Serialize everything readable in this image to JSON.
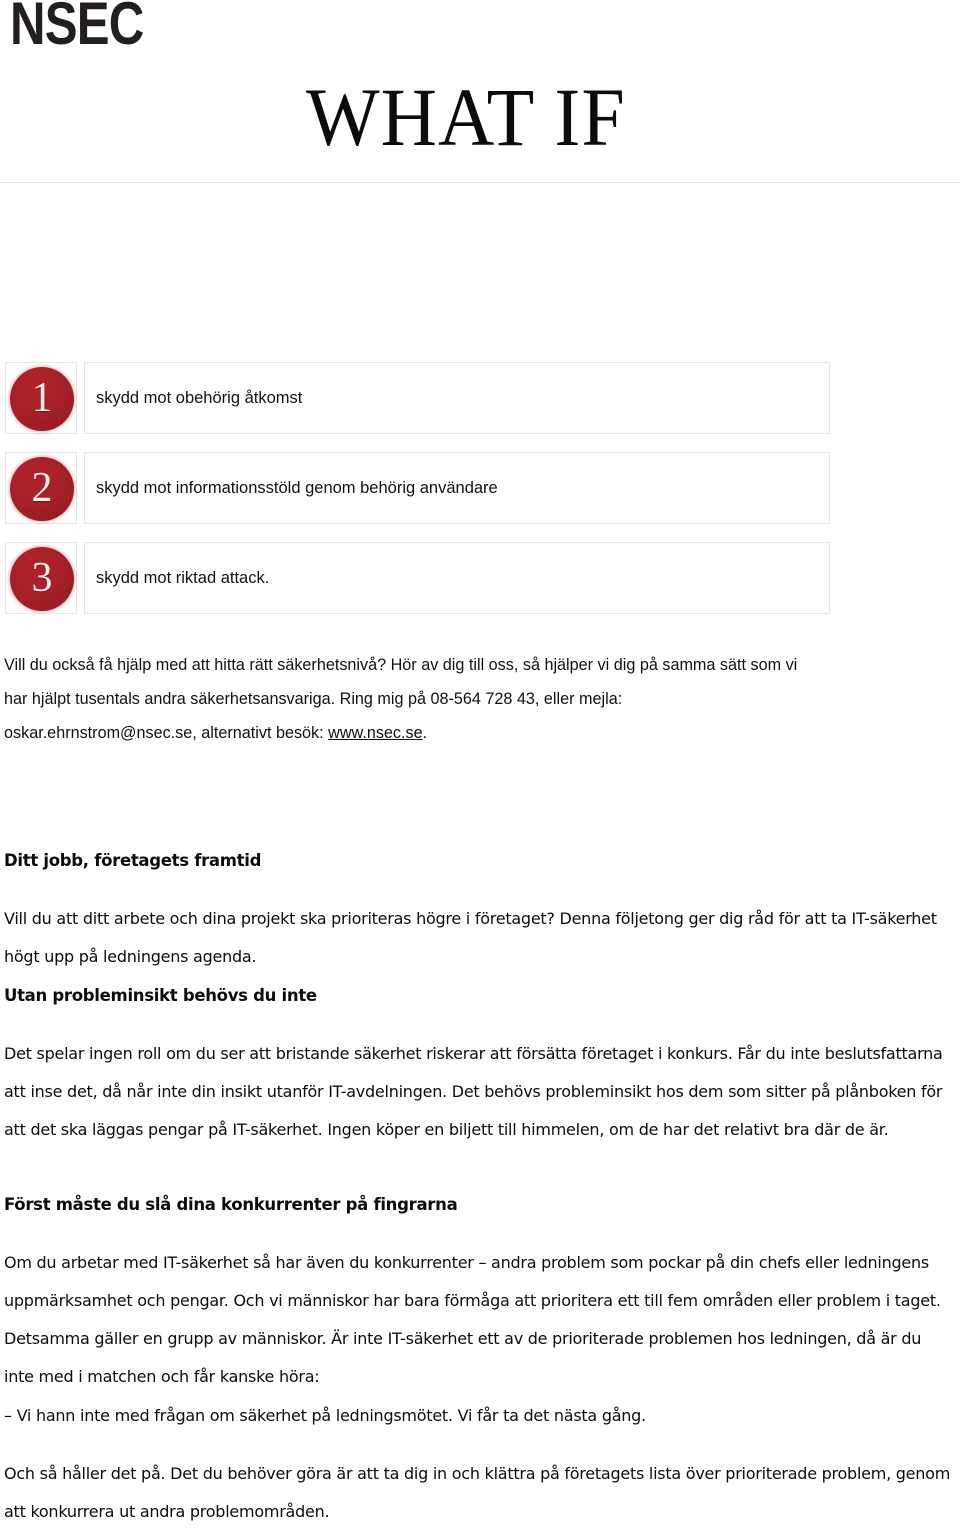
{
  "header": {
    "brand": "NSEC",
    "title": "WHAT IF"
  },
  "numbered_list": {
    "items": [
      {
        "number": "1",
        "label": "skydd mot obehörig åtkomst"
      },
      {
        "number": "2",
        "label": "skydd mot informationsstöld genom behörig användare"
      },
      {
        "number": "3",
        "label": "skydd mot riktad attack."
      }
    ]
  },
  "contact": {
    "line1": "Vill du också få hjälp med att hitta rätt säkerhetsnivå? Hör av dig till oss, så hjälper vi dig på",
    "line2": "samma sätt som vi har hjälpt tusentals andra säkerhetsansvariga. Ring mig på 08-564 728 43,",
    "line3_before": "eller mejla: oskar.ehrnstrom@nsec.se, alternativt besök: ",
    "link": "www.nsec.se",
    "line3_after": ".",
    "phone": "08-564 728 43",
    "email": "oskar.ehrnstrom@nsec.se"
  },
  "sections": [
    {
      "id": "ditt-jobb",
      "heading": "Ditt jobb, företagets framtid",
      "body": "Vill du att ditt arbete och dina projekt ska prioriteras högre i företaget? Denna följetong ger dig råd för att ta IT-säkerhet högt upp på ledningens agenda."
    },
    {
      "id": "utan-probleminsikt",
      "heading": "Utan probleminsikt behövs du inte",
      "body": "Det spelar ingen roll om du ser att bristande säkerhet riskerar att försätta företaget i konkurs. Får du inte beslutsfattarna att inse det, då når inte din insikt utanför IT-avdelningen. Det behövs probleminsikt hos dem som sitter på plånboken för att det ska läggas pengar på IT-säkerhet. Ingen köper en biljett till himmelen, om de har det relativt bra där de är."
    },
    {
      "id": "forst-maste",
      "heading": "Först måste du slå dina konkurrenter på fingrarna",
      "body": "Om du arbetar med IT-säkerhet så har även du konkurrenter – andra problem som pockar på din chefs eller ledningens uppmärksamhet och pengar. Och vi människor har bara förmåga att prioritera ett till fem områden eller problem i taget. Detsamma gäller en grupp av människor. Är inte IT-säkerhet ett av de prioriterade problemen hos ledningen, då är du inte med i matchen och får kanske höra:"
    }
  ],
  "tail": {
    "quote": "– Vi hann inte med frågan om säkerhet på ledningsmötet. Vi får ta det nästa gång.",
    "closing": "Och så håller det på. Det du behöver göra är att ta dig in och klättra på företagets lista över prioriterade problem, genom att konkurrera ut andra problemområden."
  },
  "colors": {
    "badge_red": "#a31f27",
    "rule_gray": "#e3e3e3",
    "box_border": "#e6e6e6",
    "text": "#111111"
  }
}
